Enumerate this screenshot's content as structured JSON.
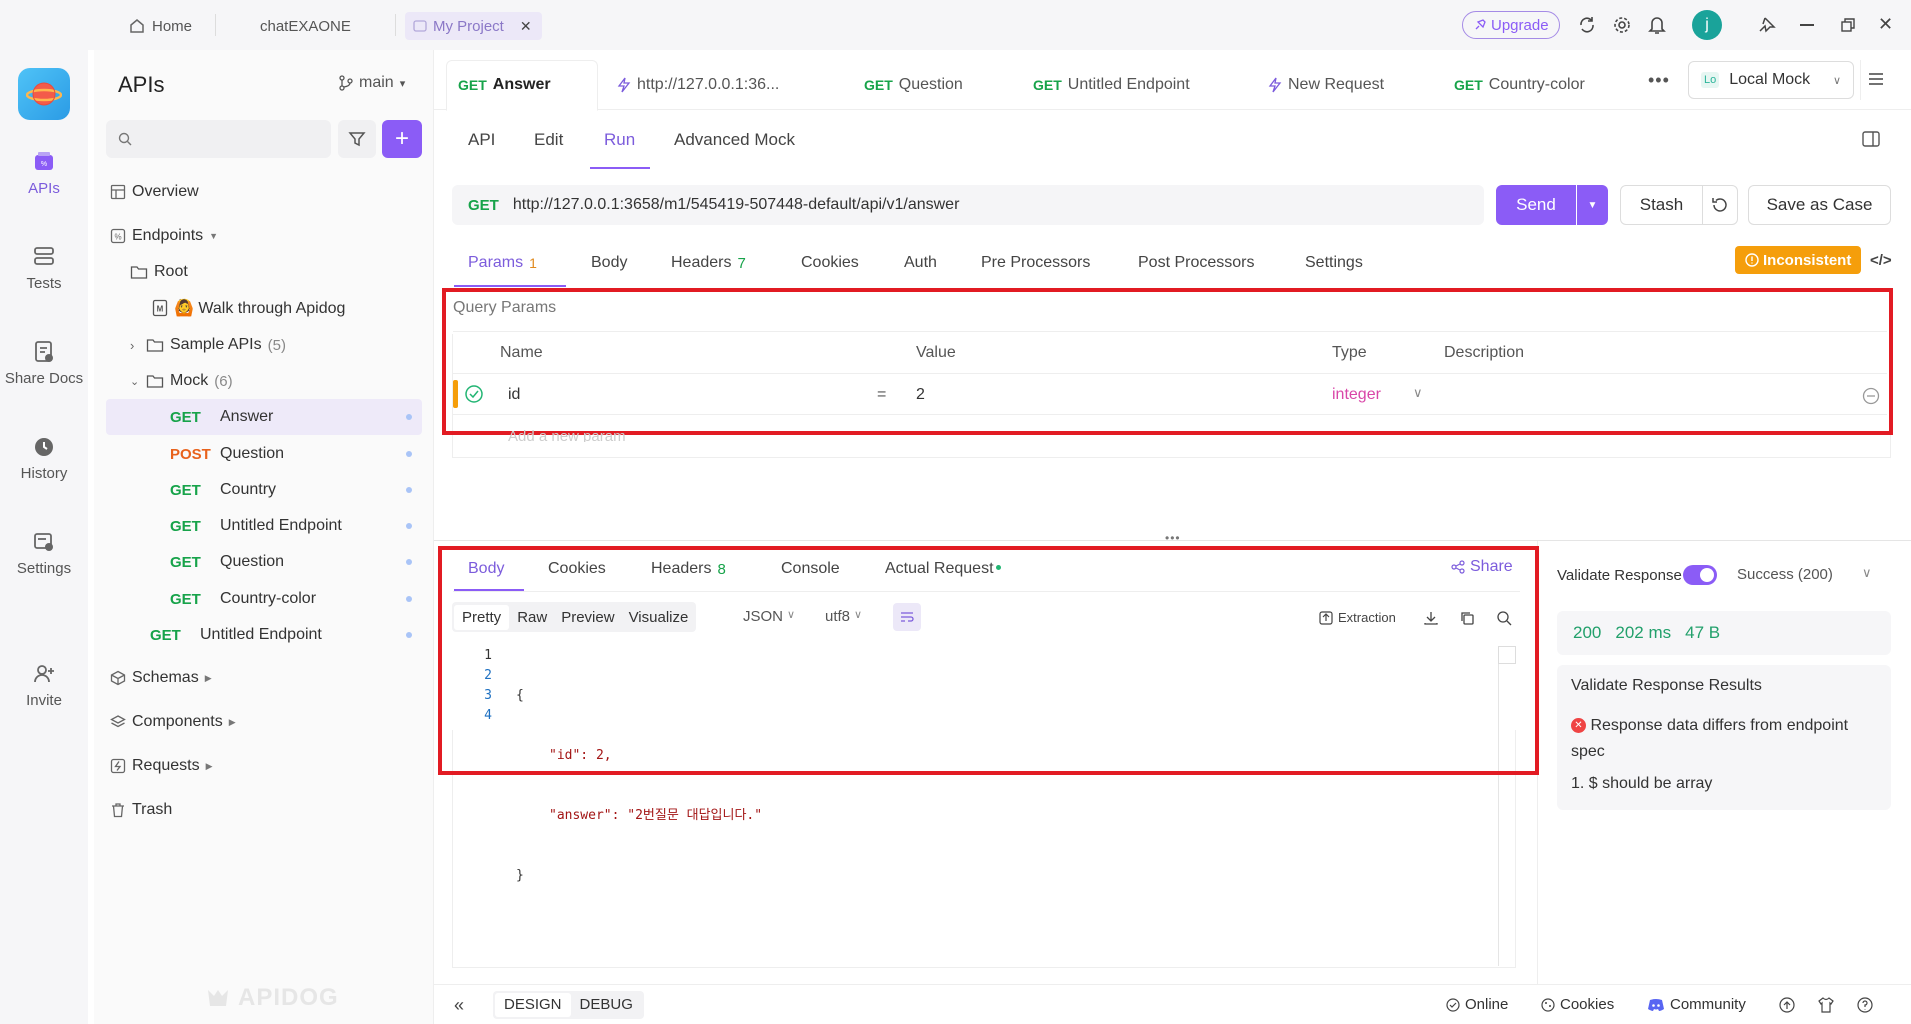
{
  "titlebar": {
    "tabs": [
      {
        "label": "Home"
      },
      {
        "label": "chatEXAONE"
      },
      {
        "label": "My Project"
      }
    ],
    "upgrade_label": "Upgrade",
    "avatar_letter": "j"
  },
  "rail": {
    "items": [
      {
        "label": "APIs"
      },
      {
        "label": "Tests"
      },
      {
        "label": "Share Docs"
      },
      {
        "label": "History"
      },
      {
        "label": "Settings"
      },
      {
        "label": "Invite"
      }
    ]
  },
  "sidebar": {
    "title": "APIs",
    "branch": "main",
    "search_placeholder": "",
    "overview": "Overview",
    "endpoints": "Endpoints",
    "root": "Root",
    "walkthrough": "🙆 Walk through Apidog",
    "sample_apis": "Sample APIs",
    "sample_count": "(5)",
    "mock": "Mock",
    "mock_count": "(6)",
    "mock_items": [
      {
        "method": "GET",
        "name": "Answer"
      },
      {
        "method": "POST",
        "name": "Question"
      },
      {
        "method": "GET",
        "name": "Country"
      },
      {
        "method": "GET",
        "name": "Untitled Endpoint"
      },
      {
        "method": "GET",
        "name": "Question"
      },
      {
        "method": "GET",
        "name": "Country-color"
      }
    ],
    "untitled": {
      "method": "GET",
      "name": "Untitled Endpoint"
    },
    "schemas": "Schemas",
    "components": "Components",
    "requests": "Requests",
    "trash": "Trash",
    "watermark": "APIDOG"
  },
  "request_tabs": [
    {
      "method": "GET",
      "name": "Answer"
    },
    {
      "method": "",
      "name": "http://127.0.0.1:36..."
    },
    {
      "method": "GET",
      "name": "Question"
    },
    {
      "method": "GET",
      "name": "Untitled Endpoint"
    },
    {
      "method": "",
      "name": "New Request"
    },
    {
      "method": "GET",
      "name": "Country-color"
    }
  ],
  "env": {
    "badge": "Lo",
    "label": "Local Mock"
  },
  "subtabs": [
    "API",
    "Edit",
    "Run",
    "Advanced Mock"
  ],
  "urlbar": {
    "method": "GET",
    "url": "http://127.0.0.1:3658/m1/545419-507448-default/api/v1/answer",
    "send": "Send",
    "stash": "Stash",
    "save_case": "Save as Case"
  },
  "param_tabs": [
    {
      "label": "Params",
      "count": "1"
    },
    {
      "label": "Body",
      "count": ""
    },
    {
      "label": "Headers",
      "count": "7"
    },
    {
      "label": "Cookies",
      "count": ""
    },
    {
      "label": "Auth",
      "count": ""
    },
    {
      "label": "Pre Processors",
      "count": ""
    },
    {
      "label": "Post Processors",
      "count": ""
    },
    {
      "label": "Settings",
      "count": ""
    }
  ],
  "inconsistent": "Inconsistent",
  "query": {
    "section_title": "Query Params",
    "headers": [
      "Name",
      "Value",
      "Type",
      "Description"
    ],
    "row": {
      "name": "id",
      "eq": "=",
      "value": "2",
      "type": "integer"
    },
    "add_placeholder": "Add a new param"
  },
  "response_tabs": [
    {
      "label": "Body",
      "count": ""
    },
    {
      "label": "Cookies",
      "count": ""
    },
    {
      "label": "Headers",
      "count": "8"
    },
    {
      "label": "Console",
      "count": ""
    },
    {
      "label": "Actual Request",
      "count": ""
    }
  ],
  "share": "Share",
  "view_modes": [
    "Pretty",
    "Raw",
    "Preview",
    "Visualize"
  ],
  "format": "JSON",
  "encoding": "utf8",
  "extraction": "Extraction",
  "code": {
    "line_numbers": [
      "1",
      "2",
      "3",
      "4"
    ],
    "lines": [
      "{",
      "\"id\": 2,",
      "\"answer\": \"2번질문 대답입니다.\"",
      "}"
    ]
  },
  "validate": {
    "label": "Validate Response",
    "status": "Success (200)",
    "code": "200",
    "time": "202 ms",
    "size": "47 B",
    "results_title": "Validate Response Results",
    "error": "Response data differs from endpoint spec",
    "detail": "1. $ should be array"
  },
  "bottom": {
    "design": "DESIGN",
    "debug": "DEBUG",
    "online": "Online",
    "cookies": "Cookies",
    "community": "Community"
  },
  "colors": {
    "accent": "#8b5cf6",
    "get": "#17a34a",
    "post": "#e8621c",
    "highlight": "#e21b23",
    "warning": "#f59e0b"
  }
}
